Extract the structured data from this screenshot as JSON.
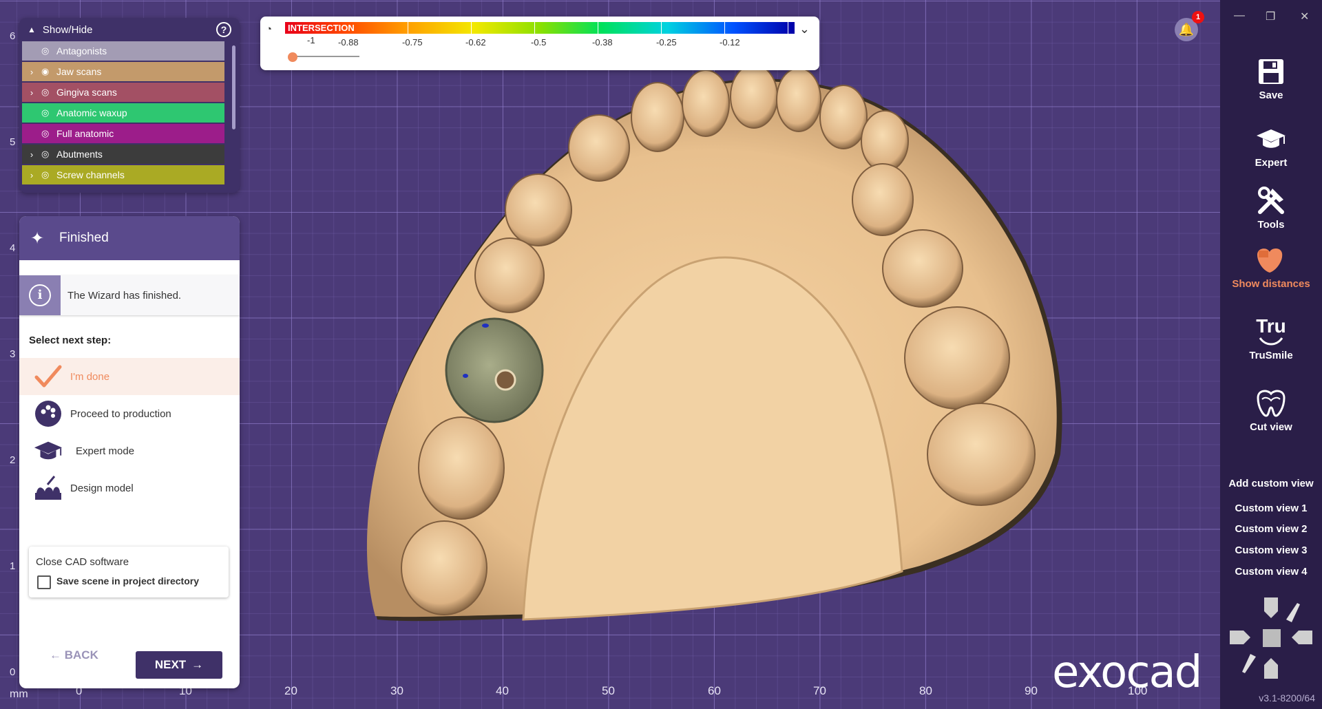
{
  "rulers": {
    "unit": "mm",
    "y_labels": [
      "6",
      "5",
      "4",
      "3",
      "2",
      "1",
      "0"
    ],
    "x_labels": [
      "0",
      "10",
      "20",
      "30",
      "40",
      "50",
      "60",
      "70",
      "80",
      "90",
      "100"
    ]
  },
  "show_hide": {
    "title": "Show/Hide",
    "help": "?",
    "layers": [
      {
        "label": "Antagonists",
        "color": "#a39cb4",
        "expand": ""
      },
      {
        "label": "Jaw scans",
        "color": "#c39a6b",
        "expand": "›"
      },
      {
        "label": "Gingiva scans",
        "color": "#a35064",
        "expand": "›"
      },
      {
        "label": "Anatomic waxup",
        "color": "#2ec771",
        "expand": ""
      },
      {
        "label": "Full anatomic",
        "color": "#9c1d8a",
        "expand": ""
      },
      {
        "label": "Abutments",
        "color": "#3c3c3c",
        "expand": "›"
      },
      {
        "label": "Screw channels",
        "color": "#aaaa24",
        "expand": "›"
      }
    ]
  },
  "wizard": {
    "title": "Finished",
    "info_text": "The Wizard has finished.",
    "select_label": "Select next step:",
    "options": [
      {
        "label": "I'm done",
        "icon": "checkmark-icon",
        "selected": true
      },
      {
        "label": "Proceed to production",
        "icon": "production-icon",
        "selected": false
      },
      {
        "label": "Expert mode",
        "icon": "graduation-cap-icon",
        "selected": false
      },
      {
        "label": "Design model",
        "icon": "design-model-icon",
        "selected": false
      }
    ],
    "close_title": "Close CAD software",
    "save_scene_label": "Save scene in project directory",
    "save_scene_checked": false,
    "back_label": "BACK",
    "next_label": "NEXT"
  },
  "scale": {
    "label": "INTERSECTION",
    "values": [
      "-1",
      "-0.88",
      "-0.75",
      "-0.62",
      "-0.5",
      "-0.38",
      "-0.25",
      "-0.12"
    ],
    "dropdown": "⌄"
  },
  "notifications": {
    "count": "1"
  },
  "toolbar": {
    "buttons": [
      {
        "label": "Save",
        "icon": "save-icon",
        "active": false
      },
      {
        "label": "Expert",
        "icon": "graduation-cap-icon",
        "active": false
      },
      {
        "label": "Tools",
        "icon": "tools-icon",
        "active": false
      },
      {
        "label": "Show distances",
        "icon": "show-distances-icon",
        "active": true
      },
      {
        "label": "TruSmile",
        "icon": "trusmile-icon",
        "active": false
      },
      {
        "label": "Cut view",
        "icon": "cut-view-icon",
        "active": false
      }
    ],
    "add_custom_view": "Add custom view",
    "custom_views": [
      "Custom view 1",
      "Custom view 2",
      "Custom view 3",
      "Custom view 4"
    ],
    "version": "v3.1-8200/64"
  },
  "brand": {
    "logo_text": "exocad",
    "accent": "#f08a5d"
  }
}
